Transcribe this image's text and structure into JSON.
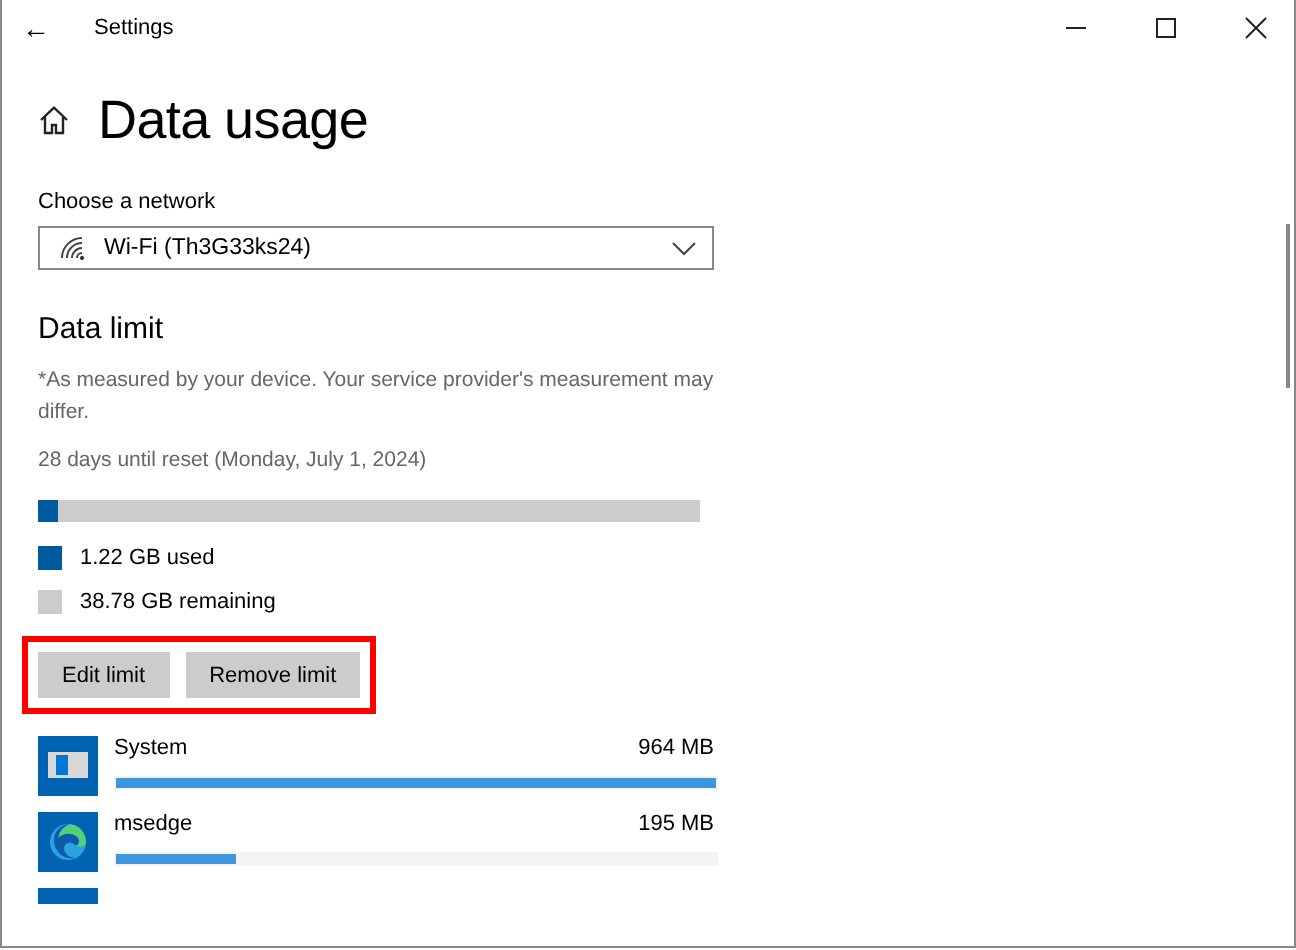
{
  "window": {
    "title": "Settings",
    "back": "←"
  },
  "page": {
    "title": "Data usage"
  },
  "network": {
    "label": "Choose a network",
    "value": "Wi-Fi (Th3G33ks24)"
  },
  "data_limit": {
    "heading": "Data limit",
    "note": "*As measured by your device. Your service provider's measurement may differ.",
    "reset": "28 days until reset (Monday, July 1, 2024)",
    "level": 0.03,
    "legend": [
      {
        "label": "1.22 GB used",
        "color": "#005a9e"
      },
      {
        "label": "38.78 GB remaining",
        "color": "#cccccc"
      }
    ],
    "buttons": [
      "Edit limit",
      "Remove limit"
    ]
  },
  "apps": [
    {
      "kind": "system",
      "name": "System",
      "usage": "964 MB",
      "level": 1.0
    },
    {
      "kind": "edge",
      "name": "msedge",
      "usage": "195 MB",
      "level": 0.2
    }
  ]
}
